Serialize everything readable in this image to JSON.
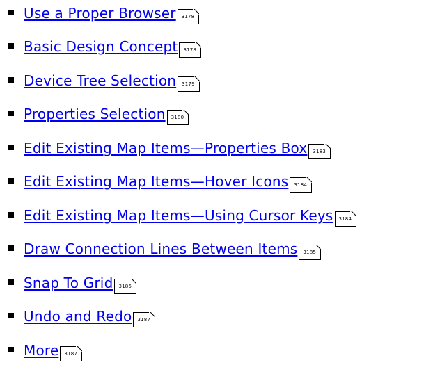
{
  "items": [
    {
      "label": "Use a Proper Browser",
      "page": "3178"
    },
    {
      "label": "Basic Design Concept",
      "page": "3178"
    },
    {
      "label": "Device Tree Selection",
      "page": "3179"
    },
    {
      "label": "Properties Selection",
      "page": "3180"
    },
    {
      "label": "Edit Existing Map Items—Properties Box",
      "page": "3183"
    },
    {
      "label": "Edit Existing Map Items—Hover Icons",
      "page": "3184"
    },
    {
      "label": "Edit Existing Map Items—Using Cursor Keys",
      "page": "3184"
    },
    {
      "label": "Draw Connection Lines Between Items",
      "page": "3185"
    },
    {
      "label": "Snap To Grid",
      "page": "3186"
    },
    {
      "label": "Undo and Redo",
      "page": "3187"
    },
    {
      "label": "More",
      "page": "3187"
    }
  ],
  "colors": {
    "link": "#0000ee",
    "bullet": "#000000",
    "background": "#ffffff"
  }
}
